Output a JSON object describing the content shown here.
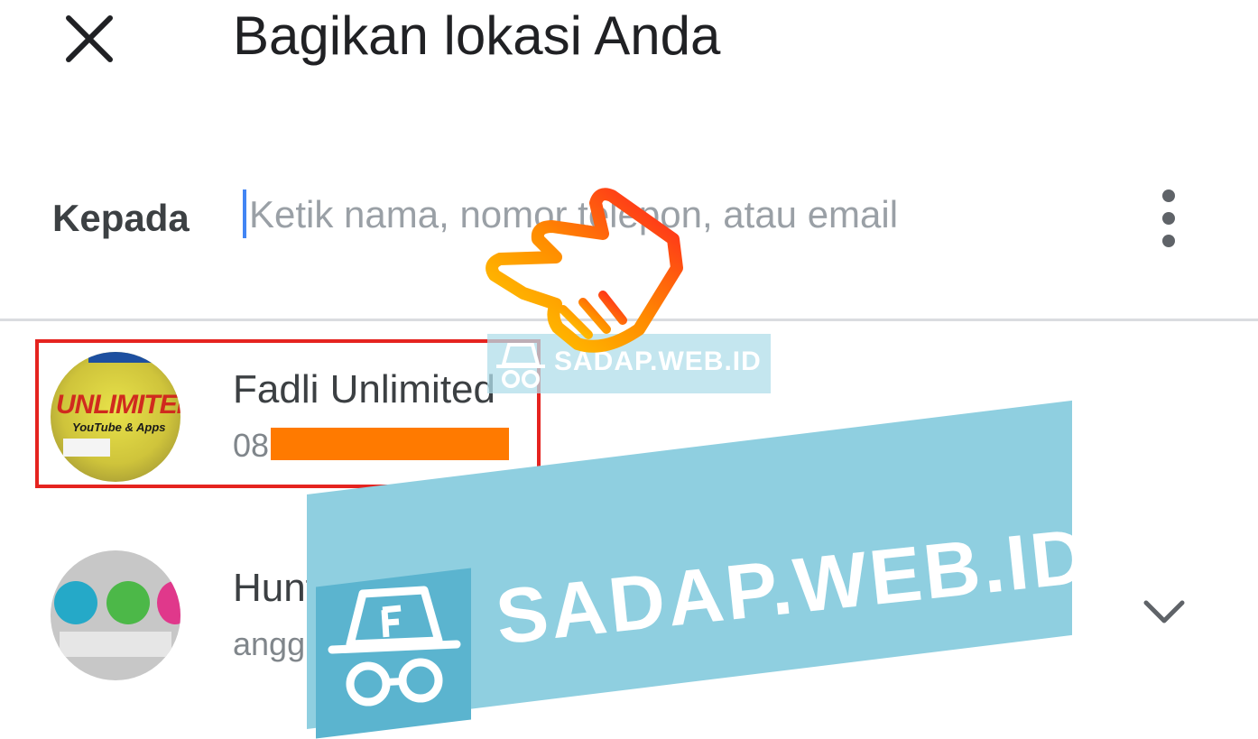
{
  "header": {
    "title": "Bagikan lokasi Anda",
    "close_icon": "close-icon"
  },
  "recipient": {
    "label": "Kepada",
    "placeholder": "Ketik nama, nomor telepon, atau email",
    "value": "",
    "more_icon": "more-vert-icon"
  },
  "contacts": [
    {
      "name": "Fadli Unlimited",
      "detail_visible": "08",
      "detail_redacted": true,
      "avatar_text": [
        "UNLIMITED",
        "YouTube & Apps"
      ],
      "highlighted": true
    },
    {
      "name": "Hunter",
      "detail_visible": "angg",
      "expand_icon": "chevron-down-icon"
    }
  ],
  "annotations": {
    "pointer_icon": "pointing-hand-icon",
    "highlight_color": "#e5231f",
    "redaction_color": "#ff7a00"
  },
  "watermark": {
    "text": "SADAP.WEB.ID",
    "logo_icon": "incognito-hat-icon",
    "color": "#8fcfe0"
  },
  "colors": {
    "caret": "#4285f4",
    "text_primary": "#202124",
    "text_secondary": "#80868b"
  }
}
